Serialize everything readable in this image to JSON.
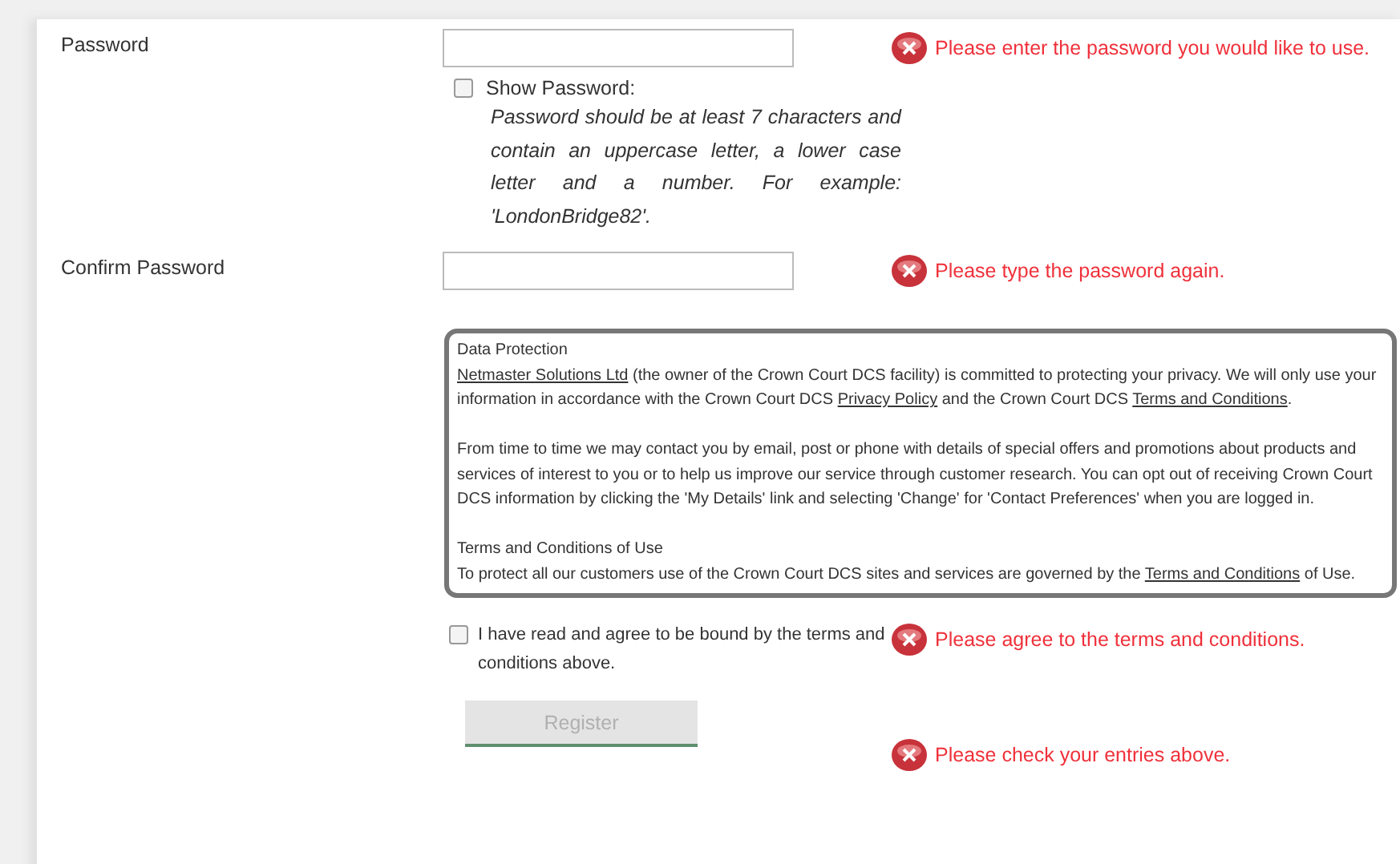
{
  "password": {
    "label": "Password",
    "show_password": {
      "label": "Show Password:",
      "checked": false
    },
    "hint": "Password should be at least 7 characters and contain an uppercase letter, a lower case letter and a number. For example: 'LondonBridge82'.",
    "error": "Please enter the password you would like to use."
  },
  "confirm_password": {
    "label": "Confirm Password",
    "error": "Please type the password again."
  },
  "data_protection": {
    "sections": [
      {
        "heading": "Data Protection",
        "parts": [
          {
            "kind": "link",
            "text": "Netmaster Solutions Ltd"
          },
          {
            "kind": "text",
            "text": " (the owner of the Crown Court DCS facility) is committed to protecting your privacy. We will only use your information in accordance with the Crown Court DCS "
          },
          {
            "kind": "link",
            "text": "Privacy Policy"
          },
          {
            "kind": "text",
            "text": " and the Crown Court DCS "
          },
          {
            "kind": "link",
            "text": "Terms and Conditions"
          },
          {
            "kind": "text",
            "text": "."
          }
        ]
      },
      {
        "parts": [
          {
            "kind": "text",
            "text": "From time to time we may contact you by email, post or phone with details of special offers and promotions about products and services of interest to you or to help us improve our service through customer research. You can opt out of receiving Crown Court DCS information by clicking the 'My Details' link and selecting 'Change' for 'Contact Preferences' when you are logged in."
          }
        ]
      },
      {
        "heading": "Terms and Conditions of Use",
        "parts": [
          {
            "kind": "text",
            "text": "To protect all our customers use of the Crown Court DCS sites and services are governed by the "
          },
          {
            "kind": "link",
            "text": "Terms and Conditions"
          },
          {
            "kind": "text",
            "text": " of Use."
          }
        ]
      }
    ]
  },
  "agree": {
    "label": "I have read and agree to be bound by the terms and conditions above.",
    "checked": false,
    "error": "Please agree to the terms and conditions."
  },
  "register": {
    "label": "Register",
    "disabled": true,
    "error": "Please check your entries above."
  }
}
